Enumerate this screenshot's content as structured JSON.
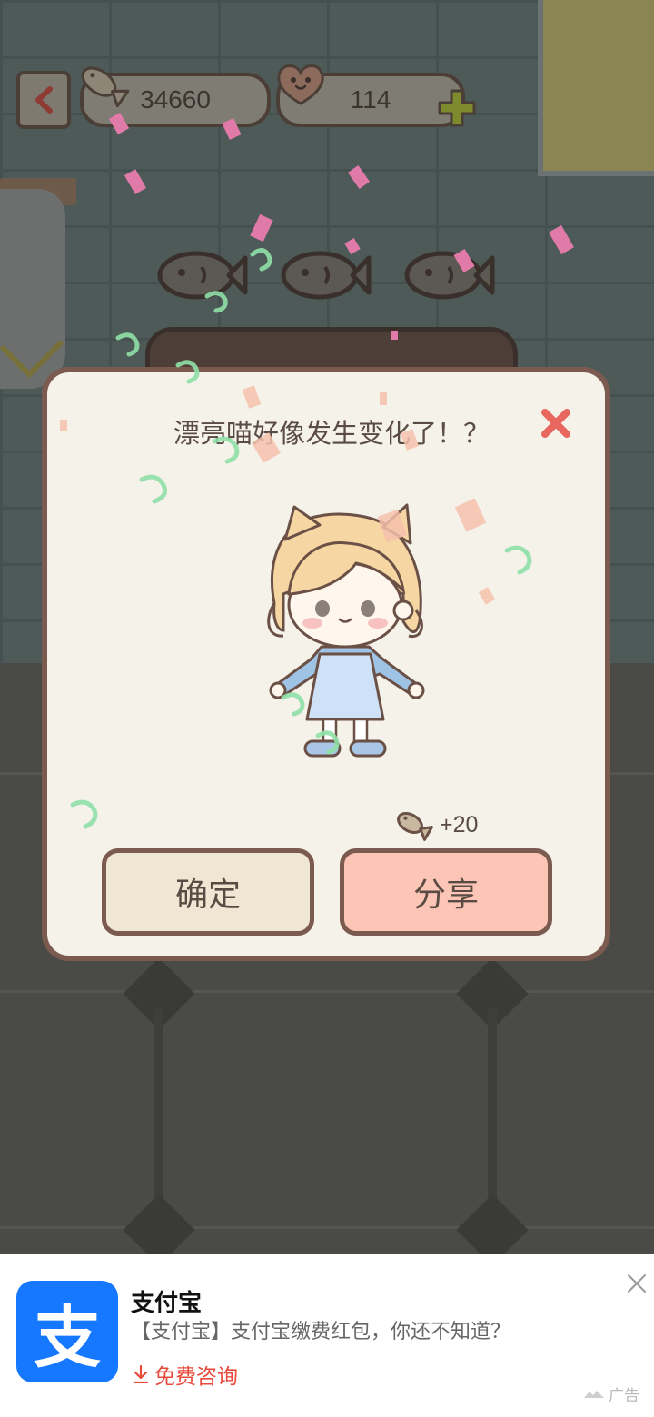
{
  "hud": {
    "back_icon": "back-arrow-icon",
    "fish_count": "34660",
    "heart_count": "114",
    "add_icon": "plus-icon"
  },
  "modal": {
    "title": "漂亮喵好像发生变化了！？",
    "reward": "+20",
    "confirm_label": "确定",
    "share_label": "分享",
    "close_icon": "close-x-icon"
  },
  "ad": {
    "app_name": "支付宝",
    "logo_glyph": "支",
    "description": "【支付宝】支付宝缴费红包，你还不知道？",
    "cta": "免费咨询",
    "label": "广告",
    "colors": {
      "brand": "#1677ff",
      "cta": "#e84b3c"
    }
  },
  "colors": {
    "modal_border": "#7b5a4f",
    "confirm_bg": "#efe6d4",
    "share_bg": "#fcc5b6",
    "close_red": "#e8675f"
  }
}
